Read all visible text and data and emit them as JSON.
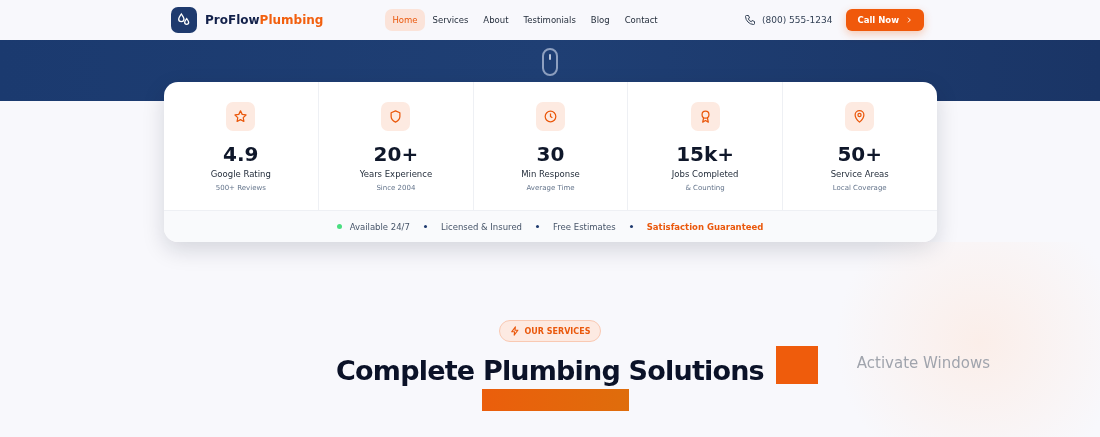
{
  "nav": {
    "brand_first": "ProFlow",
    "brand_second": "Plumbing",
    "links": [
      {
        "label": "Home",
        "selected": true
      },
      {
        "label": "Services",
        "selected": false
      },
      {
        "label": "About",
        "selected": false
      },
      {
        "label": "Testimonials",
        "selected": false
      },
      {
        "label": "Blog",
        "selected": false
      },
      {
        "label": "Contact",
        "selected": false
      }
    ],
    "phone": "(800) 555-1234",
    "cta": "Call Now"
  },
  "stats": [
    {
      "kind": "star",
      "value": "4.9",
      "label": "Google Rating",
      "sub": "500+ Reviews"
    },
    {
      "kind": "shield",
      "value": "20+",
      "label": "Years Experience",
      "sub": "Since 2004"
    },
    {
      "kind": "clock",
      "value": "30",
      "label": "Min Response",
      "sub": "Average Time"
    },
    {
      "kind": "award",
      "value": "15k+",
      "label": "Jobs Completed",
      "sub": "& Counting"
    },
    {
      "kind": "pin",
      "value": "50+",
      "label": "Service Areas",
      "sub": "Local Coverage"
    }
  ],
  "features": [
    {
      "label": "Available 24/7",
      "kind": "live"
    },
    {
      "label": "Licensed & Insured",
      "kind": "plain"
    },
    {
      "label": "Free Estimates",
      "kind": "plain"
    },
    {
      "label": "Satisfaction Guaranteed",
      "kind": "accent"
    }
  ],
  "services": {
    "badge": "OUR SERVICES",
    "heading": "Complete Plumbing Solutions"
  },
  "os_overlay": {
    "text": "Activate Windows"
  }
}
